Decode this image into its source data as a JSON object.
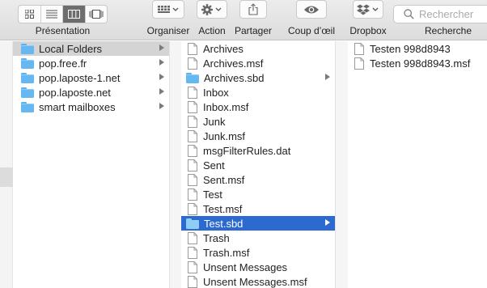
{
  "toolbar": {
    "view_label": "Présentation",
    "organize_label": "Organiser",
    "action_label": "Action",
    "share_label": "Partager",
    "quicklook_label": "Coup d’œil",
    "dropbox_label": "Dropbox",
    "search_label": "Recherche",
    "search_placeholder": "Rechercher",
    "view_modes": [
      "icon-view-icon",
      "list-view-icon",
      "column-view-icon",
      "gallery-view-icon"
    ],
    "active_view": "column-view-icon"
  },
  "column1": {
    "items": [
      {
        "label": "Local Folders",
        "icon": "folder-icon",
        "has_children": true,
        "selected": "grey"
      },
      {
        "label": "pop.free.fr",
        "icon": "folder-icon",
        "has_children": true
      },
      {
        "label": "pop.laposte-1.net",
        "icon": "folder-icon",
        "has_children": true
      },
      {
        "label": "pop.laposte.net",
        "icon": "folder-icon",
        "has_children": true
      },
      {
        "label": "smart mailboxes",
        "icon": "folder-icon",
        "has_children": true
      }
    ]
  },
  "column2": {
    "items": [
      {
        "label": "Archives",
        "icon": "document-icon"
      },
      {
        "label": "Archives.msf",
        "icon": "document-icon"
      },
      {
        "label": "Archives.sbd",
        "icon": "folder-icon",
        "has_children": true
      },
      {
        "label": "Inbox",
        "icon": "document-icon"
      },
      {
        "label": "Inbox.msf",
        "icon": "document-icon"
      },
      {
        "label": "Junk",
        "icon": "document-icon"
      },
      {
        "label": "Junk.msf",
        "icon": "document-icon"
      },
      {
        "label": "msgFilterRules.dat",
        "icon": "document-icon"
      },
      {
        "label": "Sent",
        "icon": "document-icon"
      },
      {
        "label": "Sent.msf",
        "icon": "document-icon"
      },
      {
        "label": "Test",
        "icon": "document-icon"
      },
      {
        "label": "Test.msf",
        "icon": "document-icon"
      },
      {
        "label": "Test.sbd",
        "icon": "folder-icon",
        "has_children": true,
        "selected": "blue"
      },
      {
        "label": "Trash",
        "icon": "document-icon"
      },
      {
        "label": "Trash.msf",
        "icon": "document-icon"
      },
      {
        "label": "Unsent Messages",
        "icon": "document-icon"
      },
      {
        "label": "Unsent Messages.msf",
        "icon": "document-icon"
      }
    ]
  },
  "column3": {
    "items": [
      {
        "label": "Testen 998d8943",
        "icon": "document-icon"
      },
      {
        "label": "Testen 998d8943.msf",
        "icon": "document-icon"
      }
    ]
  },
  "colors": {
    "selection_blue": "#2d6ad0",
    "selection_grey": "#d4d4d4",
    "folder_blue": "#66b8f0"
  }
}
